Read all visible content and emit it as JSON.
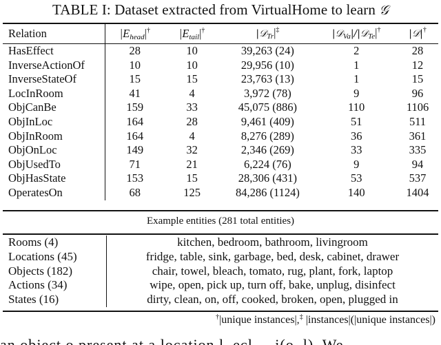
{
  "caption": {
    "prefix": "TABLE I: Dataset extracted from VirtualHome to learn ",
    "symbol": "𝒢"
  },
  "header": {
    "relation": "Relation",
    "e_head": {
      "base": "|E",
      "sub": "head",
      "close": "|",
      "mark": "†"
    },
    "e_tail": {
      "base": "|E",
      "sub": "tail",
      "close": "|",
      "mark": "†"
    },
    "d_tr": {
      "base": "|𝒟",
      "sub": "Tr",
      "close": "|",
      "mark": "‡"
    },
    "d_va_te": {
      "base1": "|𝒟",
      "sub1": "Va",
      "mid": "|/|𝒟",
      "sub2": "Te",
      "close": "|",
      "mark": "†"
    },
    "d": {
      "base": "|𝒟|",
      "mark": "†"
    }
  },
  "rows": [
    {
      "relation": "HasEffect",
      "e_head": "28",
      "e_tail": "10",
      "d_tr": "39,263 (24)",
      "d_va_te": "2",
      "d": "28"
    },
    {
      "relation": "InverseActionOf",
      "e_head": "10",
      "e_tail": "10",
      "d_tr": "29,956 (10)",
      "d_va_te": "1",
      "d": "12"
    },
    {
      "relation": "InverseStateOf",
      "e_head": "15",
      "e_tail": "15",
      "d_tr": "23,763 (13)",
      "d_va_te": "1",
      "d": "15"
    },
    {
      "relation": "LocInRoom",
      "e_head": "41",
      "e_tail": "4",
      "d_tr": "3,972 (78)",
      "d_va_te": "9",
      "d": "96"
    },
    {
      "relation": "ObjCanBe",
      "e_head": "159",
      "e_tail": "33",
      "d_tr": "45,075 (886)",
      "d_va_te": "110",
      "d": "1106"
    },
    {
      "relation": "ObjInLoc",
      "e_head": "164",
      "e_tail": "28",
      "d_tr": "9,461 (409)",
      "d_va_te": "51",
      "d": "511"
    },
    {
      "relation": "ObjInRoom",
      "e_head": "164",
      "e_tail": "4",
      "d_tr": "8,276 (289)",
      "d_va_te": "36",
      "d": "361"
    },
    {
      "relation": "ObjOnLoc",
      "e_head": "149",
      "e_tail": "32",
      "d_tr": "2,346 (269)",
      "d_va_te": "33",
      "d": "335"
    },
    {
      "relation": "ObjUsedTo",
      "e_head": "71",
      "e_tail": "21",
      "d_tr": "6,224 (76)",
      "d_va_te": "9",
      "d": "94"
    },
    {
      "relation": "ObjHasState",
      "e_head": "153",
      "e_tail": "15",
      "d_tr": "28,306 (431)",
      "d_va_te": "53",
      "d": "537"
    },
    {
      "relation": "OperatesOn",
      "e_head": "68",
      "e_tail": "125",
      "d_tr": "84,286 (1124)",
      "d_va_te": "140",
      "d": "1404"
    }
  ],
  "entities": {
    "title": "Example entities (281 total entities)",
    "rows": [
      {
        "category": "Rooms (4)",
        "values": "kitchen, bedroom, bathroom, livingroom"
      },
      {
        "category": "Locations (45)",
        "values": "fridge, table, sink, garbage, bed, desk, cabinet, drawer"
      },
      {
        "category": "Objects (182)",
        "values": "chair, towel, bleach, tomato, rug, plant, fork, laptop"
      },
      {
        "category": "Actions (34)",
        "values": "wipe, open, pick up, turn off, bake, unplug, disinfect"
      },
      {
        "category": "States (16)",
        "values": "dirty, clean, on, off, cooked, broken, open, plugged in"
      }
    ]
  },
  "footnote": {
    "mark1": "†",
    "text1": "|unique instances|,",
    "mark2": "‡",
    "text2": " |instances|(|unique instances|)"
  },
  "body_text": "an object o present at a location l, ecl ... i(o, l). We"
}
